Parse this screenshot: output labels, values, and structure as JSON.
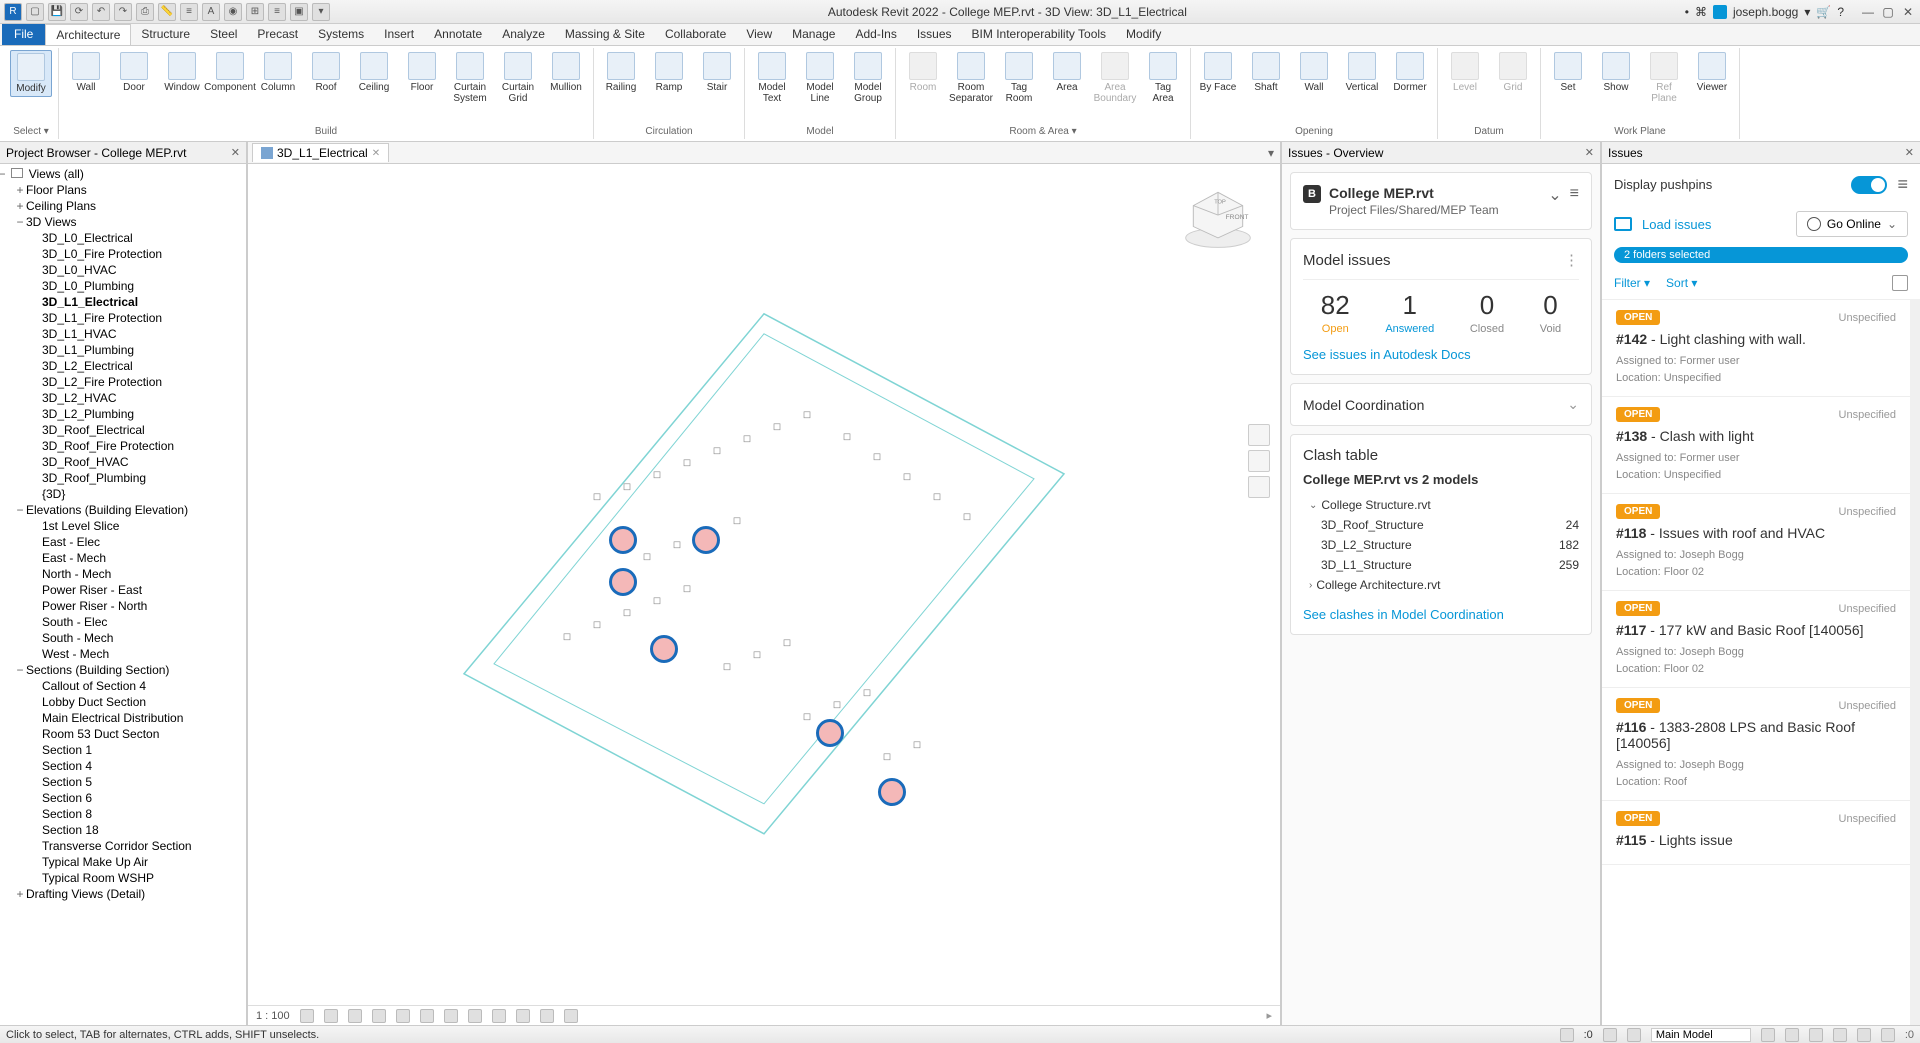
{
  "title": "Autodesk Revit 2022 - College MEP.rvt - 3D View: 3D_L1_Electrical",
  "user": "joseph.bogg",
  "menus": [
    "Architecture",
    "Structure",
    "Steel",
    "Precast",
    "Systems",
    "Insert",
    "Annotate",
    "Analyze",
    "Massing & Site",
    "Collaborate",
    "View",
    "Manage",
    "Add-Ins",
    "Issues",
    "BIM Interoperability Tools",
    "Modify"
  ],
  "active_menu": "Architecture",
  "file_label": "File",
  "ribbon": [
    {
      "name": "Select",
      "items": [
        {
          "label": "Modify",
          "selected": true
        }
      ],
      "dropdown": true
    },
    {
      "name": "Build",
      "items": [
        {
          "label": "Wall"
        },
        {
          "label": "Door"
        },
        {
          "label": "Window"
        },
        {
          "label": "Component"
        },
        {
          "label": "Column"
        },
        {
          "label": "Roof"
        },
        {
          "label": "Ceiling"
        },
        {
          "label": "Floor"
        },
        {
          "label": "Curtain System"
        },
        {
          "label": "Curtain Grid"
        },
        {
          "label": "Mullion"
        }
      ]
    },
    {
      "name": "Circulation",
      "items": [
        {
          "label": "Railing"
        },
        {
          "label": "Ramp"
        },
        {
          "label": "Stair"
        }
      ]
    },
    {
      "name": "Model",
      "items": [
        {
          "label": "Model Text"
        },
        {
          "label": "Model Line"
        },
        {
          "label": "Model Group"
        }
      ]
    },
    {
      "name": "Room & Area",
      "items": [
        {
          "label": "Room",
          "disabled": true
        },
        {
          "label": "Room Separator"
        },
        {
          "label": "Tag Room"
        },
        {
          "label": "Area"
        },
        {
          "label": "Area Boundary",
          "disabled": true
        },
        {
          "label": "Tag Area"
        }
      ],
      "dropdown": true
    },
    {
      "name": "Opening",
      "items": [
        {
          "label": "By Face"
        },
        {
          "label": "Shaft"
        },
        {
          "label": "Wall"
        },
        {
          "label": "Vertical"
        },
        {
          "label": "Dormer"
        }
      ]
    },
    {
      "name": "Datum",
      "items": [
        {
          "label": "Level",
          "disabled": true
        },
        {
          "label": "Grid",
          "disabled": true
        }
      ]
    },
    {
      "name": "Work Plane",
      "items": [
        {
          "label": "Set"
        },
        {
          "label": "Show"
        },
        {
          "label": "Ref Plane",
          "disabled": true
        },
        {
          "label": "Viewer"
        }
      ]
    }
  ],
  "project_browser": {
    "title": "Project Browser - College MEP.rvt",
    "root": "Views (all)",
    "tree": [
      {
        "label": "Floor Plans",
        "level": 1,
        "exp": "+"
      },
      {
        "label": "Ceiling Plans",
        "level": 1,
        "exp": "+"
      },
      {
        "label": "3D Views",
        "level": 1,
        "exp": "−"
      },
      {
        "label": "3D_L0_Electrical",
        "level": 2
      },
      {
        "label": "3D_L0_Fire Protection",
        "level": 2
      },
      {
        "label": "3D_L0_HVAC",
        "level": 2
      },
      {
        "label": "3D_L0_Plumbing",
        "level": 2
      },
      {
        "label": "3D_L1_Electrical",
        "level": 2,
        "bold": true
      },
      {
        "label": "3D_L1_Fire Protection",
        "level": 2
      },
      {
        "label": "3D_L1_HVAC",
        "level": 2
      },
      {
        "label": "3D_L1_Plumbing",
        "level": 2
      },
      {
        "label": "3D_L2_Electrical",
        "level": 2
      },
      {
        "label": "3D_L2_Fire Protection",
        "level": 2
      },
      {
        "label": "3D_L2_HVAC",
        "level": 2
      },
      {
        "label": "3D_L2_Plumbing",
        "level": 2
      },
      {
        "label": "3D_Roof_Electrical",
        "level": 2
      },
      {
        "label": "3D_Roof_Fire Protection",
        "level": 2
      },
      {
        "label": "3D_Roof_HVAC",
        "level": 2
      },
      {
        "label": "3D_Roof_Plumbing",
        "level": 2
      },
      {
        "label": "{3D}",
        "level": 2
      },
      {
        "label": "Elevations (Building Elevation)",
        "level": 1,
        "exp": "−"
      },
      {
        "label": "1st Level Slice",
        "level": 2
      },
      {
        "label": "East - Elec",
        "level": 2
      },
      {
        "label": "East - Mech",
        "level": 2
      },
      {
        "label": "North - Mech",
        "level": 2
      },
      {
        "label": "Power Riser - East",
        "level": 2
      },
      {
        "label": "Power Riser - North",
        "level": 2
      },
      {
        "label": "South - Elec",
        "level": 2
      },
      {
        "label": "South - Mech",
        "level": 2
      },
      {
        "label": "West - Mech",
        "level": 2
      },
      {
        "label": "Sections (Building Section)",
        "level": 1,
        "exp": "−"
      },
      {
        "label": "Callout of Section 4",
        "level": 2
      },
      {
        "label": "Lobby Duct Section",
        "level": 2
      },
      {
        "label": "Main Electrical Distribution",
        "level": 2
      },
      {
        "label": "Room 53 Duct Secton",
        "level": 2
      },
      {
        "label": "Section 1",
        "level": 2
      },
      {
        "label": "Section 4",
        "level": 2
      },
      {
        "label": "Section 5",
        "level": 2
      },
      {
        "label": "Section 6",
        "level": 2
      },
      {
        "label": "Section 8",
        "level": 2
      },
      {
        "label": "Section 18",
        "level": 2
      },
      {
        "label": "Transverse Corridor Section",
        "level": 2
      },
      {
        "label": "Typical Make Up Air",
        "level": 2
      },
      {
        "label": "Typical Room WSHP",
        "level": 2
      },
      {
        "label": "Drafting Views (Detail)",
        "level": 1,
        "exp": "+"
      }
    ]
  },
  "view_tab": {
    "icon": "cube",
    "label": "3D_L1_Electrical"
  },
  "view_scale": "1 : 100",
  "issues_overview": {
    "title": "Issues - Overview",
    "project_name": "College MEP.rvt",
    "project_path": "Project Files/Shared/MEP Team",
    "model_issues_label": "Model issues",
    "stats": {
      "open": 82,
      "answered": 1,
      "closed": 0,
      "void": 0
    },
    "stat_labels": {
      "open": "Open",
      "answered": "Answered",
      "closed": "Closed",
      "void": "Void"
    },
    "docs_link": "See issues in Autodesk Docs",
    "model_coord": "Model Coordination",
    "clash_title": "Clash table",
    "clash_sub": "College MEP.rvt vs 2 models",
    "clash_groups": [
      {
        "label": "College Structure.rvt",
        "expanded": true,
        "rows": [
          {
            "name": "3D_Roof_Structure",
            "count": 24
          },
          {
            "name": "3D_L2_Structure",
            "count": 182
          },
          {
            "name": "3D_L1_Structure",
            "count": 259
          }
        ]
      },
      {
        "label": "College Architecture.rvt",
        "expanded": false,
        "rows": []
      }
    ],
    "clash_link": "See clashes in Model Coordination"
  },
  "issues_panel": {
    "title": "Issues",
    "pushpin_label": "Display pushpins",
    "load_label": "Load issues",
    "go_online": "Go Online",
    "folders_badge": "2 folders selected",
    "filter_label": "Filter",
    "sort_label": "Sort",
    "issues": [
      {
        "status": "OPEN",
        "unspec": "Unspecified",
        "id": "#142",
        "title": "Light clashing with wall.",
        "assigned": "Assigned to: Former user",
        "location": "Location: Unspecified"
      },
      {
        "status": "OPEN",
        "unspec": "Unspecified",
        "id": "#138",
        "title": "Clash with light",
        "assigned": "Assigned to: Former user",
        "location": "Location: Unspecified"
      },
      {
        "status": "OPEN",
        "unspec": "Unspecified",
        "id": "#118",
        "title": "Issues with roof and HVAC",
        "assigned": "Assigned to: Joseph Bogg",
        "location": "Location: Floor 02"
      },
      {
        "status": "OPEN",
        "unspec": "Unspecified",
        "id": "#117",
        "title": "177 kW and Basic Roof [140056]",
        "assigned": "Assigned to: Joseph Bogg",
        "location": "Location: Floor 02"
      },
      {
        "status": "OPEN",
        "unspec": "Unspecified",
        "id": "#116",
        "title": "1383-2808 LPS and Basic Roof [140056]",
        "assigned": "Assigned to: Joseph Bogg",
        "location": "Location: Roof"
      },
      {
        "status": "OPEN",
        "unspec": "Unspecified",
        "id": "#115",
        "title": "Lights issue",
        "assigned": "",
        "location": ""
      }
    ]
  },
  "statusbar": {
    "hint": "Click to select, TAB for alternates, CTRL adds, SHIFT unselects.",
    "model": "Main Model"
  }
}
